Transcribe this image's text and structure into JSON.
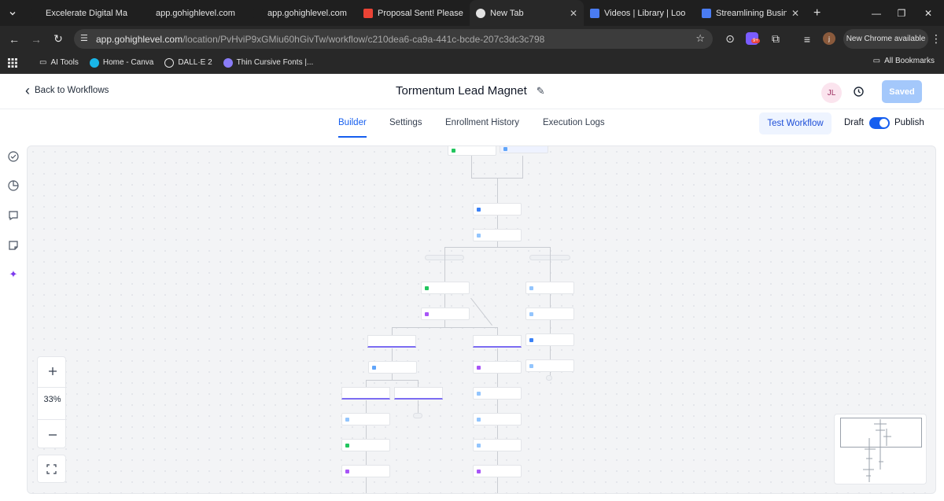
{
  "browser": {
    "tabs": [
      {
        "label": "Excelerate Digital Ma",
        "favicon_color": "#1f1f1f"
      },
      {
        "label": "app.gohighlevel.com",
        "favicon_color": "#1f1f1f"
      },
      {
        "label": "app.gohighlevel.com",
        "favicon_color": "#1f1f1f"
      },
      {
        "label": "Proposal Sent! Please",
        "favicon_color": "#ea4335"
      },
      {
        "label": "New Tab",
        "favicon_color": "#e3e3e3"
      },
      {
        "label": "Videos | Library | Loo",
        "favicon_color": "#4a7cf2"
      },
      {
        "label": "Streamlining Busines",
        "favicon_color": "#4a7cf2"
      }
    ],
    "url_host": "app.gohighlevel.com",
    "url_path": "/location/PvHviP9xGMiu60hGivTw/workflow/c210dea6-ca9a-441c-bcde-207c3dc3c798",
    "new_chrome_label": "New Chrome available",
    "extension_badge": "9+",
    "bookmarks": [
      {
        "label": "AI Tools",
        "icon_color": "#e3e3e3"
      },
      {
        "label": "Home - Canva",
        "icon_color": "#19b6e8"
      },
      {
        "label": "DALL·E 2",
        "icon_color": "#e3e3e3"
      },
      {
        "label": "Thin Cursive Fonts |...",
        "icon_color": "#8a7cf7"
      }
    ],
    "all_bookmarks_label": "All Bookmarks"
  },
  "header": {
    "back_label": "Back to Workflows",
    "title": "Tormentum Lead Magnet",
    "avatar_initials": "JL",
    "saved_label": "Saved"
  },
  "subnav": {
    "tabs": [
      {
        "label": "Builder",
        "active": true
      },
      {
        "label": "Settings",
        "active": false
      },
      {
        "label": "Enrollment History",
        "active": false
      },
      {
        "label": "Execution Logs",
        "active": false
      }
    ],
    "test_label": "Test Workflow",
    "draft_label": "Draft",
    "publish_label": "Publish"
  },
  "zoom": {
    "level": "33%"
  },
  "colors": {
    "accent": "#155eef",
    "saved": "#a4c8fb"
  }
}
